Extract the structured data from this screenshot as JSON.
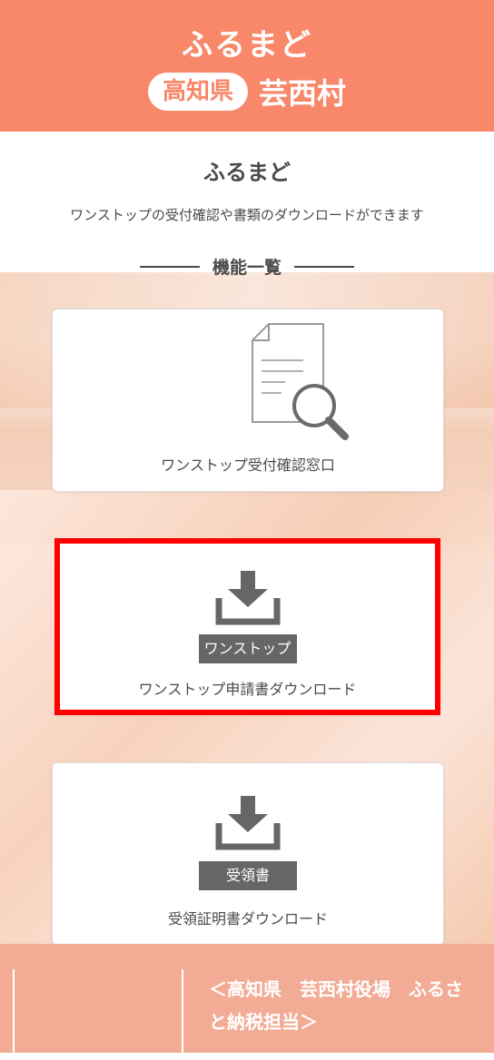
{
  "header": {
    "brand": "ふるまど",
    "prefecture": "高知県",
    "village": "芸西村"
  },
  "main": {
    "title": "ふるまど",
    "description": "ワンストップの受付確認や書類のダウンロードができます",
    "section_heading": "機能一覧"
  },
  "cards": [
    {
      "label": "ワンストップ受付確認窓口",
      "icon": "document-search-icon"
    },
    {
      "label": "ワンストップ申請書ダウンロード",
      "icon": "download-icon",
      "tag": "ワンストップ"
    },
    {
      "label": "受領証明書ダウンロード",
      "icon": "download-icon",
      "tag": "受領書"
    }
  ],
  "footer": {
    "office": "＜高知県　芸西村役場　ふるさと納税担当＞"
  },
  "colors": {
    "brand": "#f9876a",
    "footer": "#f2ab94",
    "highlight": "#ff0000"
  }
}
